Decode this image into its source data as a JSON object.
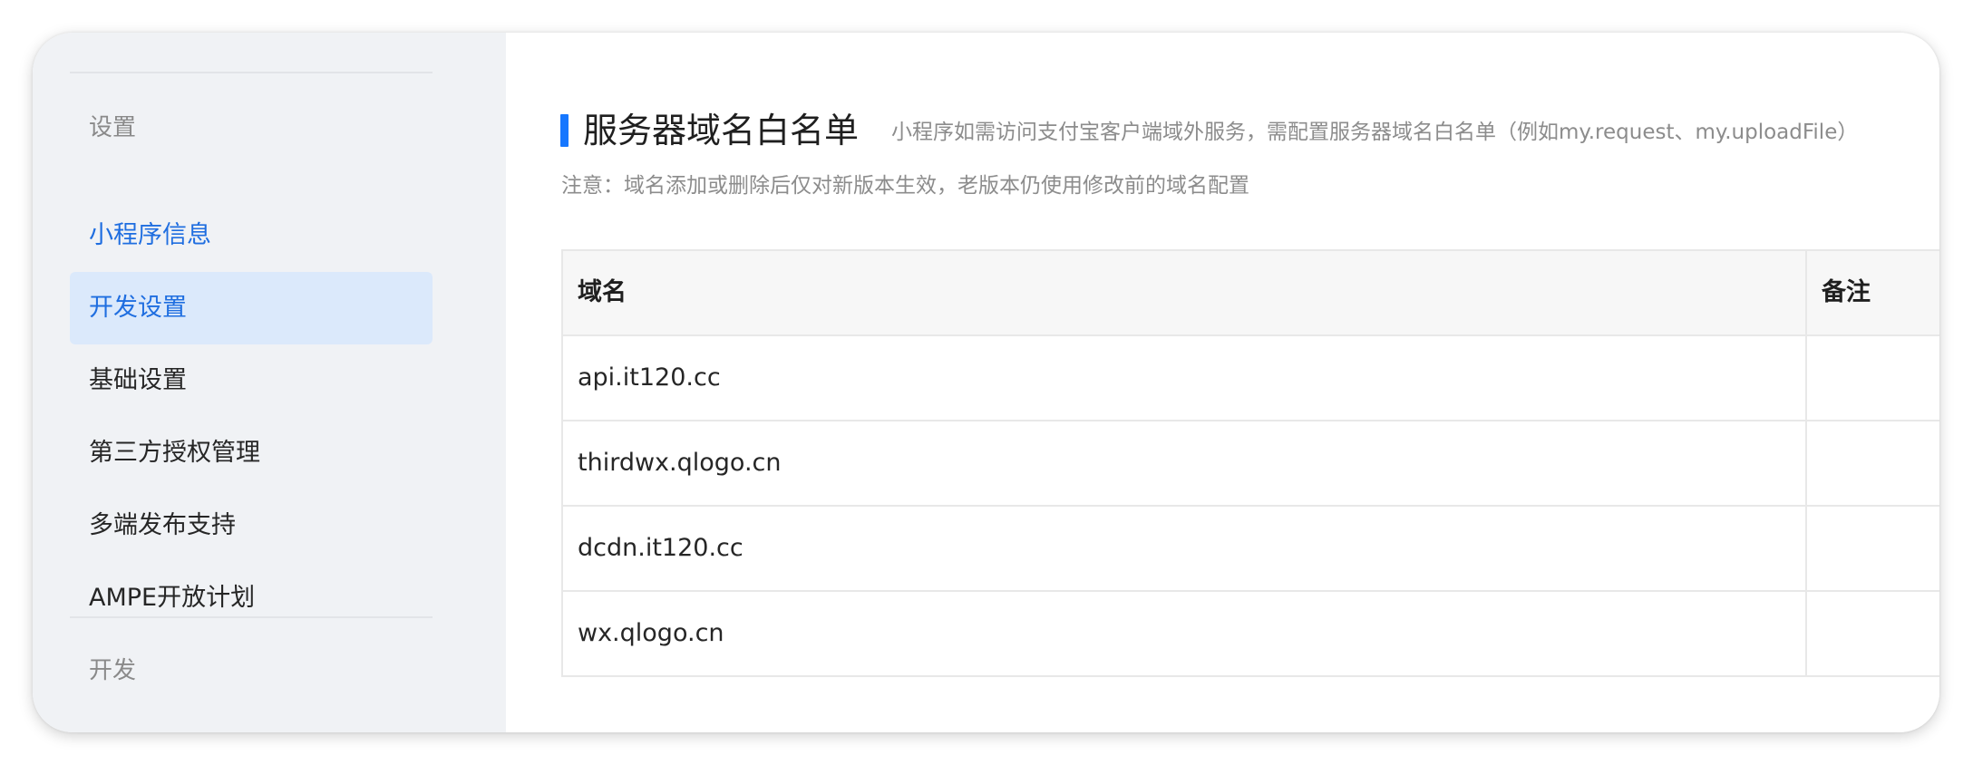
{
  "sidebar": {
    "section_settings": "设置",
    "items": [
      {
        "label": "小程序信息"
      },
      {
        "label": "开发设置"
      },
      {
        "label": "基础设置"
      },
      {
        "label": "第三方授权管理"
      },
      {
        "label": "多端发布支持"
      },
      {
        "label": "AMPE开放计划"
      }
    ],
    "active_item": "开发设置",
    "section_dev": "开发"
  },
  "main": {
    "title": "服务器域名白名单",
    "subtitle": "小程序如需访问支付宝客户端域外服务，需配置服务器域名白名单（例如my.request、my.uploadFile）",
    "notice": "注意：域名添加或删除后仅对新版本生效，老版本仍使用修改前的域名配置",
    "table": {
      "headers": {
        "domain": "域名",
        "note": "备注"
      },
      "rows": [
        {
          "domain": "api.it120.cc",
          "note": ""
        },
        {
          "domain": "thirdwx.qlogo.cn",
          "note": ""
        },
        {
          "domain": "dcdn.it120.cc",
          "note": ""
        },
        {
          "domain": "wx.qlogo.cn",
          "note": ""
        }
      ]
    }
  },
  "colors": {
    "accent": "#1677ff",
    "link": "#1f6ee0",
    "active_bg": "#dbe9fb",
    "sidebar_bg": "#f0f2f5"
  }
}
